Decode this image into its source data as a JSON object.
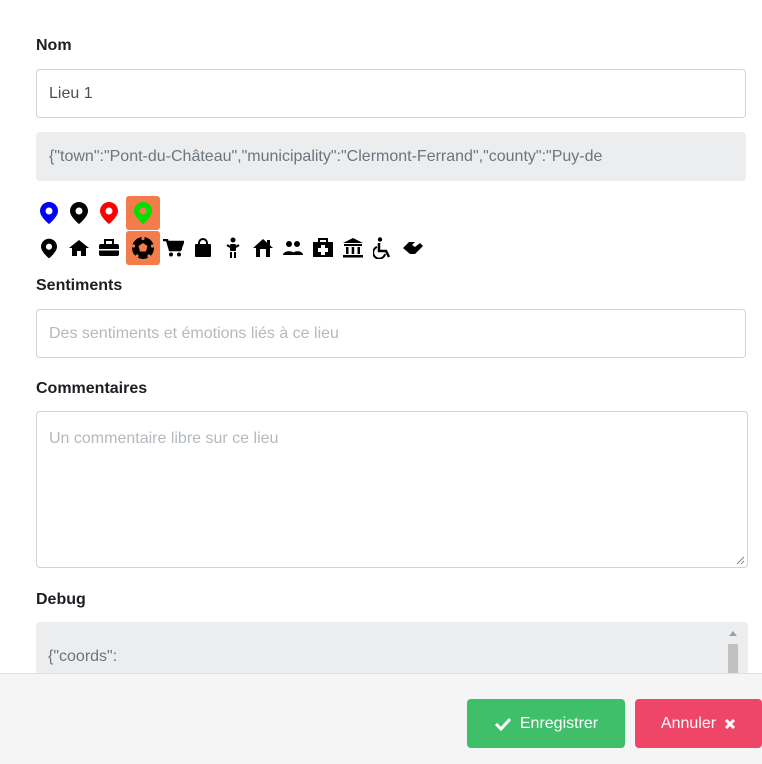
{
  "nom": {
    "label": "Nom",
    "value": "Lieu 1"
  },
  "address_json": "{\"town\":\"Pont-du-Château\",\"municipality\":\"Clermont-Ferrand\",\"county\":\"Puy-de",
  "markers": {
    "colors": [
      {
        "name": "blue-marker",
        "color": "#0000ff"
      },
      {
        "name": "black-marker",
        "color": "#000000"
      },
      {
        "name": "red-marker",
        "color": "#ff0000"
      },
      {
        "name": "green-marker",
        "color": "#00e000",
        "selected": true
      }
    ],
    "selection_color": "#f47c4a",
    "categories": [
      "map-marker-icon",
      "home-icon",
      "briefcase-icon",
      "soccer-ball-icon",
      "shopping-cart-icon",
      "shopping-bag-icon",
      "child-icon",
      "school-icon",
      "users-icon",
      "hospital-icon",
      "bank-icon",
      "wheelchair-icon",
      "handshake-icon"
    ],
    "selected_category": "soccer-ball-icon"
  },
  "sentiments": {
    "label": "Sentiments",
    "placeholder": "Des sentiments et émotions liés à ce lieu"
  },
  "commentaires": {
    "label": "Commentaires",
    "placeholder": "Un commentaire libre sur ce lieu"
  },
  "debug": {
    "label": "Debug",
    "value": "{\"coords\":"
  },
  "footer": {
    "save_label": "Enregistrer",
    "cancel_label": "Annuler"
  },
  "colors": {
    "save": "#3fbf6a",
    "cancel": "#ef4567"
  }
}
